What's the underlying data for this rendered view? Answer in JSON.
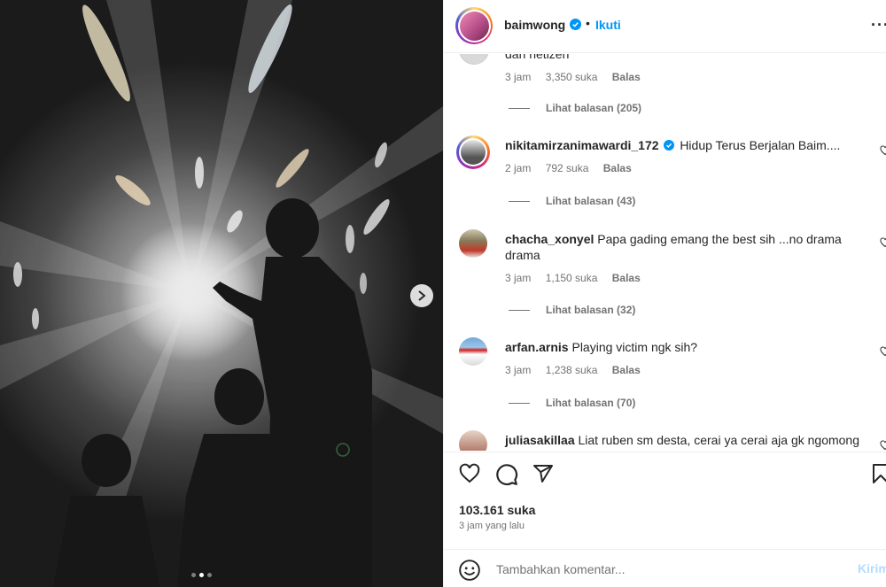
{
  "header": {
    "username": "baimwong",
    "bullet": "•",
    "follow_label": "Ikuti",
    "more_label": "···"
  },
  "carousel": {
    "slide_count": 3,
    "active_slide": 2
  },
  "comments": [
    {
      "partial_text": "dari netizen",
      "time": "3 jam",
      "likes": "3,350 suka",
      "reply_label": "Balas",
      "view_replies": "Lihat balasan (205)"
    },
    {
      "username": "nikitamirzanimawardi_172",
      "verified": true,
      "text": "Hidup Terus Berjalan Baim....",
      "time": "2 jam",
      "likes": "792 suka",
      "reply_label": "Balas",
      "view_replies": "Lihat balasan (43)"
    },
    {
      "username": "chacha_xonyel",
      "text": "Papa gading emang the best sih ...no drama",
      "text_line2": "drama",
      "time": "3 jam",
      "likes": "1,150 suka",
      "reply_label": "Balas",
      "view_replies": "Lihat balasan (32)"
    },
    {
      "username": "arfan.arnis",
      "text": "Playing victim ngk sih?",
      "time": "3 jam",
      "likes": "1,238 suka",
      "reply_label": "Balas",
      "view_replies": "Lihat balasan (70)"
    },
    {
      "username": "juliasakillaa",
      "text": "Liat ruben sm desta, cerai ya cerai aja gk ngomong"
    }
  ],
  "post": {
    "likes": "103.161 suka",
    "time_ago": "3 jam yang lalu"
  },
  "add_comment": {
    "placeholder": "Tambahkan komentar...",
    "post_label": "Kirim"
  },
  "colors": {
    "accent": "#0095f6",
    "muted": "#737373",
    "post_disabled": "#b3dbff"
  }
}
